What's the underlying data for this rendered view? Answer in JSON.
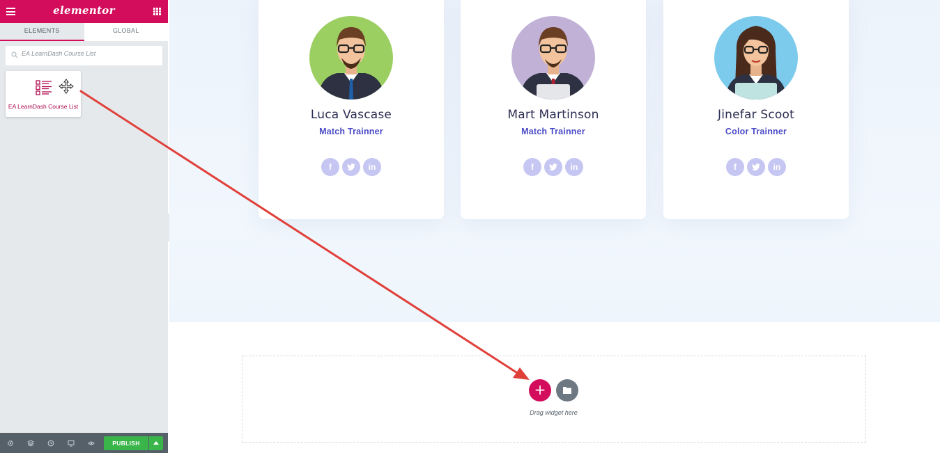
{
  "editor": {
    "logo": "elementor",
    "tabs": [
      "ELEMENTS",
      "GLOBAL"
    ],
    "search": {
      "value": "EA LearnDash Course List"
    },
    "widget": {
      "label": "EA LearnDash Course List",
      "icon": "course-list-icon"
    },
    "footer": {
      "publish_label": "PUBLISH",
      "icons": [
        "settings-icon",
        "navigator-icon",
        "history-icon",
        "responsive-icon",
        "preview-icon"
      ]
    }
  },
  "team": [
    {
      "name": "Luca Vascase",
      "role": "Match Trainner",
      "avatar_bg": "#9ccf62",
      "socials": [
        "f",
        "t",
        "in"
      ]
    },
    {
      "name": "Mart Martinson",
      "role": "Match Trainner",
      "avatar_bg": "#c1b1d7",
      "socials": [
        "f",
        "t",
        "in"
      ]
    },
    {
      "name": "Jinefar Scoot",
      "role": "Color Trainner",
      "avatar_bg": "#7dcbec",
      "socials": [
        "f",
        "t",
        "in"
      ]
    }
  ],
  "dropzone": {
    "text": "Drag widget here",
    "add_label": "+"
  },
  "colors": {
    "brand": "#d30c5c",
    "accent": "#4b4bc6",
    "publish": "#39b54a",
    "annotation_arrow": "#e0403a"
  }
}
